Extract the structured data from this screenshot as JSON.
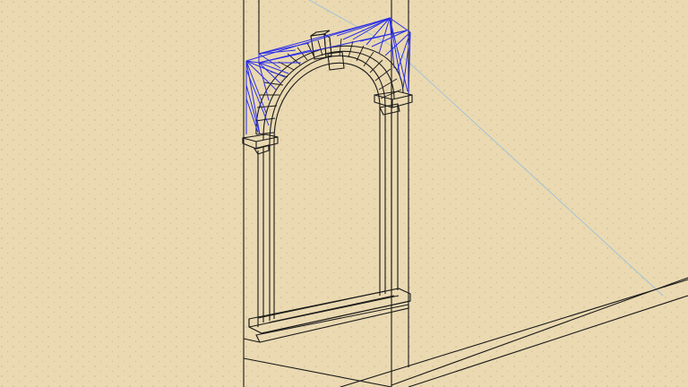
{
  "viewport": {
    "background": "#ead9b1",
    "dot_color": "#c9b888",
    "edge_color": "#1a1a1a",
    "selection_color": "#2a2ee8",
    "axis_color": "#9fc2d8",
    "grid_visible": true
  }
}
